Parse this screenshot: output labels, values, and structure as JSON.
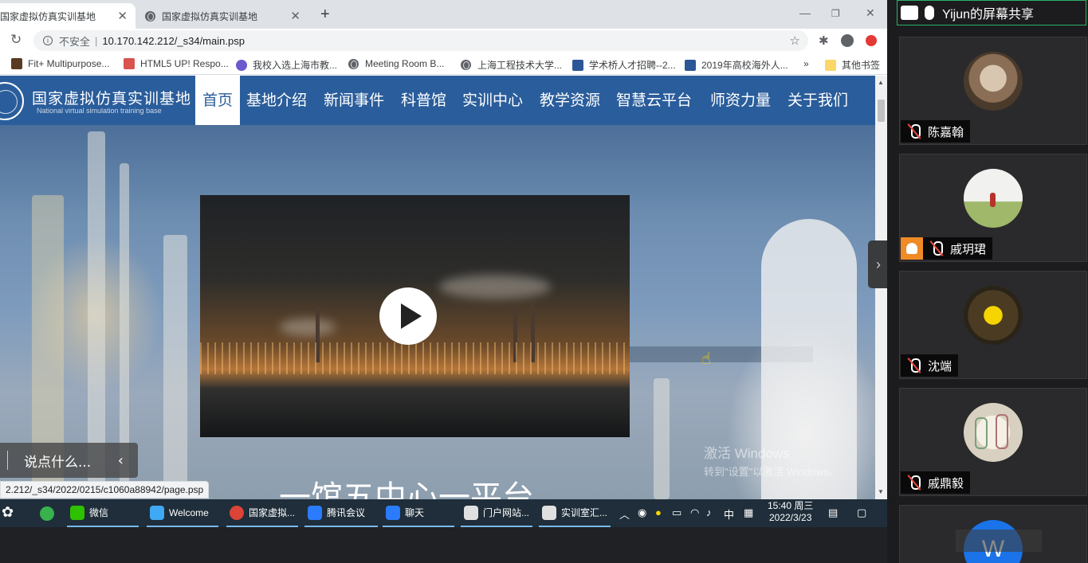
{
  "browser": {
    "tabs": [
      {
        "title": "国家虚拟仿真实训基地",
        "active": true
      },
      {
        "title": "国家虚拟仿真实训基地",
        "active": false
      }
    ],
    "new_tab": "+",
    "address": {
      "security": "不安全",
      "separator": "|",
      "url": "10.170.142.212/_s34/main.psp"
    },
    "bookmarks": [
      {
        "label": "Fit+ Multipurpose...",
        "color": "#5a3a22"
      },
      {
        "label": "HTML5 UP! Respo...",
        "color": "#d9534f"
      },
      {
        "label": "我校入选上海市教...",
        "color": "#6a5acd"
      },
      {
        "label": "Meeting Room B...",
        "color": "#5f6368"
      },
      {
        "label": "上海工程技术大学...",
        "color": "#5f6368"
      },
      {
        "label": "学术桥人才招聘--2...",
        "color": "#2b5797"
      },
      {
        "label": "2019年高校海外人...",
        "color": "#2b5797"
      }
    ],
    "bookmarks_more": "»",
    "other_bookmarks": "其他书签",
    "status_url": "2.212/_s34/2022/0215/c1060a88942/page.psp"
  },
  "site": {
    "name": "国家虚拟仿真实训基地",
    "name_en": "National virtual simulation training base",
    "nav": [
      "首页",
      "基地介绍",
      "新闻事件",
      "科普馆",
      "实训中心",
      "教学资源",
      "智慧云平台",
      "师资力量",
      "关于我们"
    ],
    "headline": "一馆五中心一平台",
    "comment_placeholder": "说点什么...",
    "watermark_line1": "激活 Windows",
    "watermark_line2": "转到\"设置\"以激活 Windows。"
  },
  "taskbar": {
    "items": [
      {
        "label": "微信",
        "color": "#2dc100"
      },
      {
        "label": "Welcome",
        "color": "#3fa9f5"
      },
      {
        "label": "国家虚拟...",
        "color": "#db4437"
      },
      {
        "label": "腾讯会议",
        "color": "#2b7bff"
      },
      {
        "label": "聊天",
        "color": "#2b7bff"
      },
      {
        "label": "门户网站...",
        "color": "#e0e0e0"
      },
      {
        "label": "实训室汇...",
        "color": "#e0e0e0"
      }
    ],
    "ime": "中",
    "time": "15:40 周三",
    "date": "2022/3/23"
  },
  "meeting": {
    "share_label": "Yijun的屏幕共享",
    "participants": [
      {
        "name": "陈嘉翰",
        "avatar": "cat-photo",
        "host_badge": false
      },
      {
        "name": "戚玥珺",
        "avatar": "field-photo",
        "host_badge": true
      },
      {
        "name": "沈端",
        "avatar": "flower-photo",
        "host_badge": false
      },
      {
        "name": "戚鼎毅",
        "avatar": "sketch-photo",
        "host_badge": false
      }
    ],
    "last_avatar_letter": "W"
  }
}
